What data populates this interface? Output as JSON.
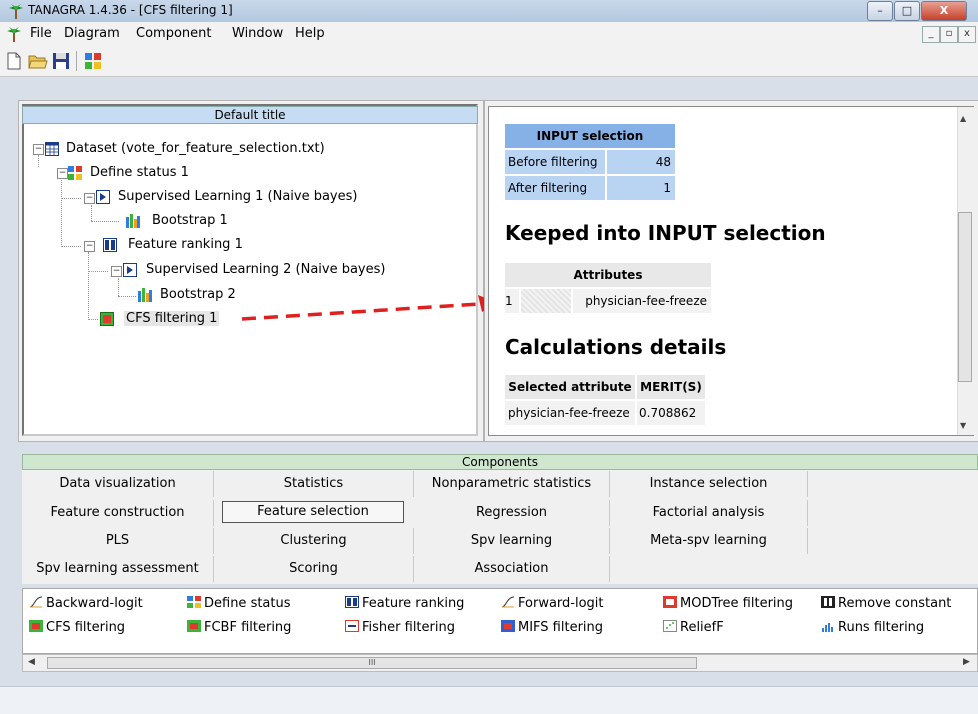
{
  "window": {
    "title": "TANAGRA 1.4.36 - [CFS filtering 1]",
    "minimize": "–",
    "maximize": "□",
    "close": "X"
  },
  "menu": {
    "items": [
      "File",
      "Diagram",
      "Component",
      "Window",
      "Help"
    ],
    "mdi": [
      "_",
      "▫",
      "x"
    ]
  },
  "left_pane": {
    "header": "Default title",
    "tree": [
      {
        "label": "Dataset (vote_for_feature_selection.txt)",
        "icon": "table-icon"
      },
      {
        "label": "Define status 1",
        "icon": "define-status-icon"
      },
      {
        "label": "Supervised Learning 1 (Naive bayes)",
        "icon": "play-icon"
      },
      {
        "label": "Bootstrap 1",
        "icon": "bootstrap-icon"
      },
      {
        "label": "Feature ranking 1",
        "icon": "feature-ranking-icon"
      },
      {
        "label": "Supervised Learning 2 (Naive bayes)",
        "icon": "play-icon"
      },
      {
        "label": "Bootstrap 2",
        "icon": "bootstrap-icon"
      },
      {
        "label": "CFS filtering 1",
        "icon": "cfs-filtering-icon"
      }
    ]
  },
  "right_pane": {
    "input_table": {
      "header": "INPUT selection",
      "rows": [
        {
          "label": "Before filtering",
          "value": "48"
        },
        {
          "label": "After filtering",
          "value": "1"
        }
      ]
    },
    "keeped_title": "Keeped into INPUT selection",
    "attributes_table": {
      "header": "Attributes",
      "rows": [
        {
          "index": "1",
          "name": "physician-fee-freeze"
        }
      ]
    },
    "calc_title": "Calculations details",
    "calc_table": {
      "headers": [
        "Selected attribute",
        "MERIT(S)"
      ],
      "rows": [
        {
          "attribute": "physician-fee-freeze",
          "merit": "0.708862"
        }
      ]
    }
  },
  "components": {
    "header": "Components",
    "tabs": [
      [
        "Data visualization",
        "Statistics",
        "Nonparametric statistics",
        "Instance selection"
      ],
      [
        "Feature construction",
        "Feature selection",
        "Regression",
        "Factorial analysis"
      ],
      [
        "PLS",
        "Clustering",
        "Spv learning",
        "Meta-spv learning"
      ],
      [
        "Spv learning assessment",
        "Scoring",
        "Association",
        ""
      ]
    ],
    "items": [
      [
        "Backward-logit",
        "Define status",
        "Feature ranking",
        "Forward-logit",
        "MODTree filtering",
        "Remove constant"
      ],
      [
        "CFS filtering",
        "FCBF filtering",
        "Fisher filtering",
        "MIFS filtering",
        "ReliefF",
        "Runs filtering"
      ]
    ],
    "scroll_mark": "III"
  },
  "colors": {
    "accent": "#86b1e6",
    "arrow": "#e0201f"
  }
}
